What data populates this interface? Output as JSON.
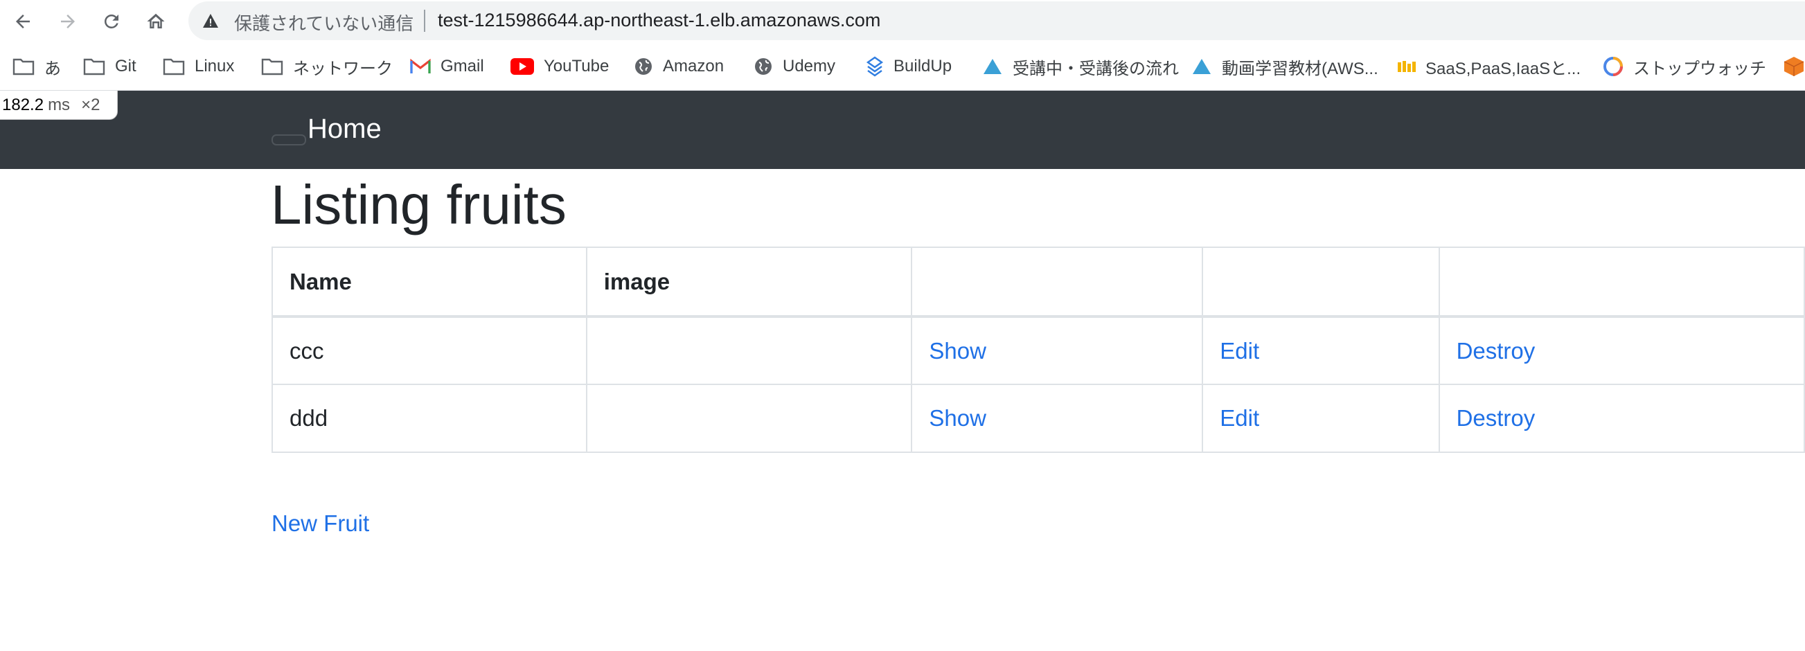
{
  "browser": {
    "security_status": "保護されていない通信",
    "url": "test-1215986644.ap-northeast-1.elb.amazonaws.com",
    "icons": {
      "back": "arrow-left-icon",
      "forward": "arrow-right-icon",
      "reload": "reload-icon",
      "home": "home-icon",
      "warning": "warning-triangle-icon"
    },
    "bookmarks": [
      {
        "label": "あ",
        "icon": "folder-icon"
      },
      {
        "label": "Git",
        "icon": "folder-icon"
      },
      {
        "label": "Linux",
        "icon": "folder-icon"
      },
      {
        "label": "ネットワーク",
        "icon": "folder-icon"
      },
      {
        "label": "Gmail",
        "icon": "gmail-icon"
      },
      {
        "label": "YouTube",
        "icon": "youtube-icon"
      },
      {
        "label": "Amazon",
        "icon": "globe-icon"
      },
      {
        "label": "Udemy",
        "icon": "globe-icon"
      },
      {
        "label": "BuildUp",
        "icon": "buildup-icon"
      },
      {
        "label": "受講中・受講後の流れ",
        "icon": "triangle-icon"
      },
      {
        "label": "動画学習教材(AWS...",
        "icon": "triangle-icon"
      },
      {
        "label": "SaaS,PaaS,IaaSと...",
        "icon": "bars-icon"
      },
      {
        "label": "ストップウォッチ",
        "icon": "stopwatch-icon"
      },
      {
        "label": "",
        "icon": "box-icon"
      }
    ]
  },
  "perf_badge": {
    "value": "182.2",
    "unit": "ms",
    "multiplier": "×2"
  },
  "navbar": {
    "home_label": "Home"
  },
  "page": {
    "title": "Listing fruits",
    "table": {
      "headers": [
        "Name",
        "image",
        "",
        "",
        ""
      ],
      "rows": [
        {
          "name": "ccc",
          "image": "",
          "show": "Show",
          "edit": "Edit",
          "destroy": "Destroy"
        },
        {
          "name": "ddd",
          "image": "",
          "show": "Show",
          "edit": "Edit",
          "destroy": "Destroy"
        }
      ]
    },
    "new_link": "New Fruit"
  },
  "colors": {
    "navbar_bg": "#343a40",
    "link": "#1f70e6",
    "text": "#212529",
    "table_border": "#dee2e6"
  }
}
